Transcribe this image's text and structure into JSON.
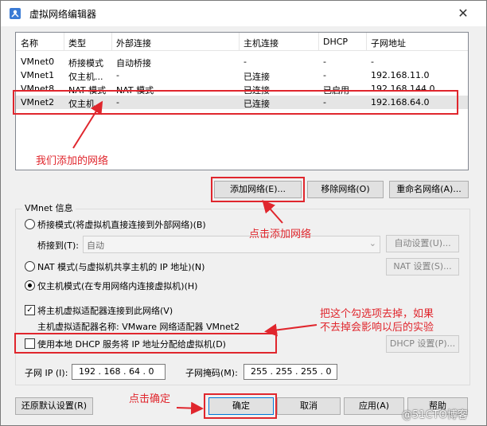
{
  "window": {
    "title": "虚拟网络编辑器",
    "close_glyph": "✕"
  },
  "table": {
    "headers": [
      "名称",
      "类型",
      "外部连接",
      "主机连接",
      "DHCP",
      "子网地址"
    ],
    "rows": [
      {
        "name": "VMnet0",
        "type": "桥接模式",
        "external": "自动桥接",
        "host": "-",
        "dhcp": "-",
        "subnet": "-"
      },
      {
        "name": "VMnet1",
        "type": "仅主机...",
        "external": "-",
        "host": "已连接",
        "dhcp": "-",
        "subnet": "192.168.11.0"
      },
      {
        "name": "VMnet8",
        "type": "NAT 模式",
        "external": "NAT 模式",
        "host": "已连接",
        "dhcp": "已启用",
        "subnet": "192.168.144.0"
      },
      {
        "name": "VMnet2",
        "type": "仅主机...",
        "external": "-",
        "host": "已连接",
        "dhcp": "-",
        "subnet": "192.168.64.0"
      }
    ]
  },
  "list_buttons": {
    "add": "添加网络(E)...",
    "remove": "移除网络(O)",
    "rename": "重命名网络(A)..."
  },
  "vmnet_info": {
    "label": "VMnet 信息",
    "bridged": "桥接模式(将虚拟机直接连接到外部网络)(B)",
    "bridge_to_label": "桥接到(T):",
    "bridge_to_value": "自动",
    "auto_settings": "自动设置(U)...",
    "nat": "NAT 模式(与虚拟机共享主机的 IP 地址)(N)",
    "nat_settings": "NAT 设置(S)...",
    "host_only": "仅主机模式(在专用网络内连接虚拟机)(H)",
    "connect_adapter": "将主机虚拟适配器连接到此网络(V)",
    "adapter_name": "主机虚拟适配器名称: VMware 网络适配器 VMnet2",
    "use_dhcp": "使用本地 DHCP 服务将 IP 地址分配给虚拟机(D)",
    "dhcp_settings": "DHCP 设置(P)...",
    "subnet_ip_label": "子网 IP (I):",
    "subnet_ip": "192 . 168 . 64 . 0",
    "subnet_mask_label": "子网掩码(M):",
    "subnet_mask": "255 . 255 . 255 . 0"
  },
  "footer": {
    "restore": "还原默认设置(R)",
    "ok": "确定",
    "cancel": "取消",
    "apply": "应用(A)",
    "help": "帮助"
  },
  "annotations": {
    "added_network": "我们添加的网络",
    "click_add": "点击添加网络",
    "uncheck_line1": "把这个勾选项去掉，如果",
    "uncheck_line2": "不去掉会影响以后的实验",
    "click_ok": "点击确定",
    "color": "#e0262d"
  },
  "watermark": "@51CTO博客",
  "icons": [
    "vmware-network-icon",
    "close-icon",
    "dropdown-arrow-icon",
    "checkmark-icon"
  ]
}
